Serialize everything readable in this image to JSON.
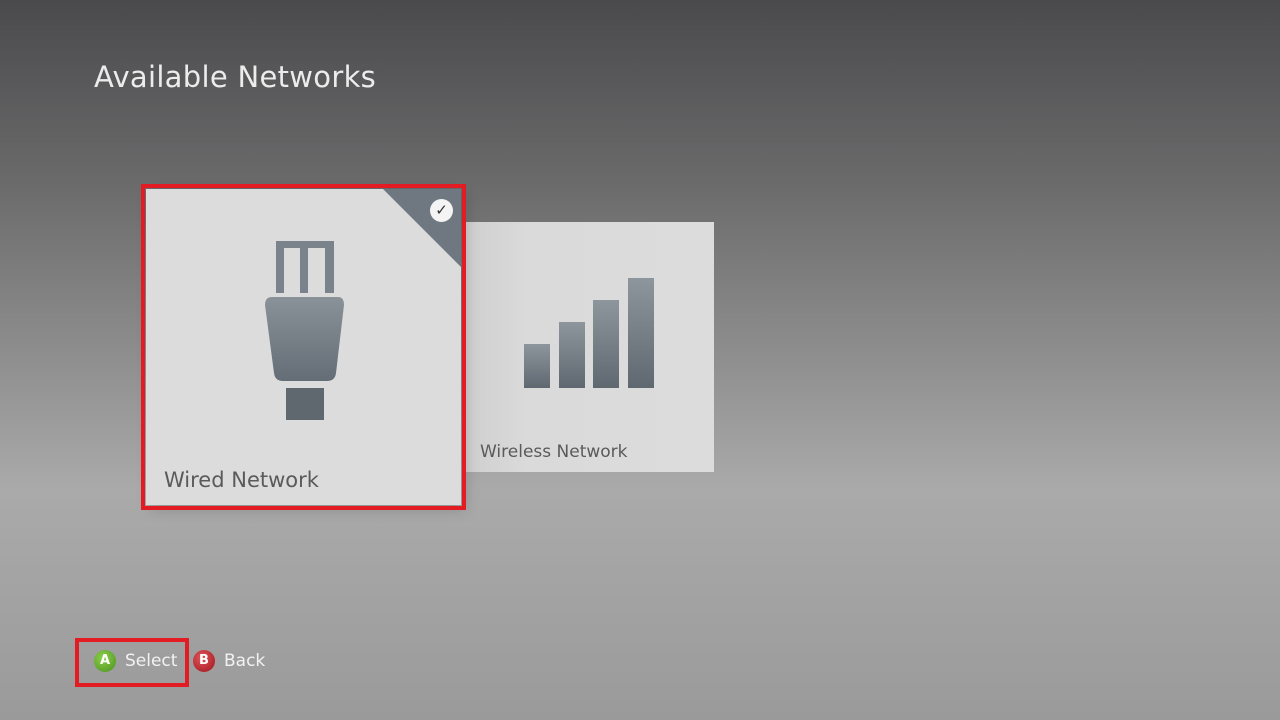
{
  "header": {
    "title": "Available Networks"
  },
  "networks": [
    {
      "label": "Wired Network",
      "icon": "ethernet-plug-icon",
      "selected": true
    },
    {
      "label": "Wireless Network",
      "icon": "signal-bars-icon",
      "selected": false
    }
  ],
  "footer": {
    "select": {
      "glyph": "A",
      "label": "Select"
    },
    "back": {
      "glyph": "B",
      "label": "Back"
    }
  },
  "colors": {
    "focus": "#e31b23",
    "a_button": "#5ea32b",
    "b_button": "#b3282e",
    "icon": "#6f7880",
    "tile": "#dcdcdc"
  }
}
